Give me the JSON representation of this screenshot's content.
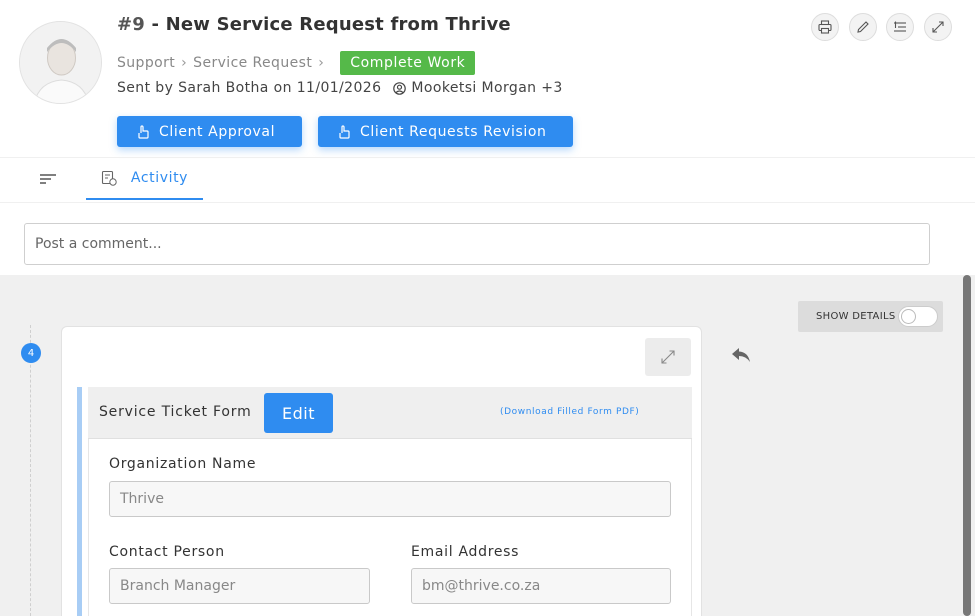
{
  "header": {
    "ticket_number": "#9",
    "title_dash": " - ",
    "title": "New Service Request from Thrive",
    "breadcrumb": [
      "Support",
      "Service Request"
    ],
    "status": "Complete Work",
    "sent_by": "Sent by Sarah Botha on 11/01/2026",
    "assignees": "Mooketsi Morgan +3",
    "actions": {
      "client_approval": "Client Approval",
      "client_requests_revision": "Client Requests Revision"
    }
  },
  "tabs": {
    "activity": "Activity"
  },
  "comment": {
    "placeholder": "Post a comment..."
  },
  "activity": {
    "show_details": "SHOW DETAILS",
    "entry_number": "4"
  },
  "form": {
    "title": "Service Ticket Form",
    "edit_label": "Edit",
    "download_link": "(Download Filled Form PDF)",
    "fields": {
      "organization_name": {
        "label": "Organization Name",
        "value": "Thrive"
      },
      "contact_person": {
        "label": "Contact Person",
        "value": "Branch Manager"
      },
      "email_address": {
        "label": "Email Address",
        "value": "bm@thrive.co.za"
      }
    }
  },
  "colors": {
    "primary": "#2f8cf0",
    "status_green": "#55b949",
    "form_accent": "#a8cdf5"
  }
}
